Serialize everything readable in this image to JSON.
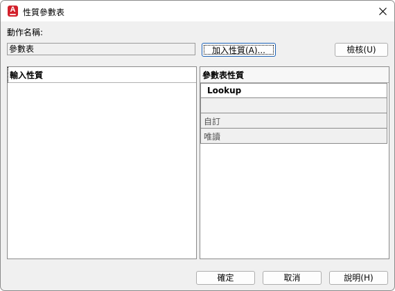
{
  "window": {
    "title": "性質參數表"
  },
  "action": {
    "name_label": "動作名稱:",
    "name_value": "參數表"
  },
  "buttons": {
    "add_property": "加入性質(A)...",
    "audit": "檢核(U)",
    "ok": "確定",
    "cancel": "取消",
    "help": "說明(H)"
  },
  "input_panel": {
    "header": "輸入性質"
  },
  "lookup_panel": {
    "header": "參數表性質",
    "rows": [
      "Lookup",
      "",
      "自訂",
      "唯讀"
    ]
  },
  "colors": {
    "accent": "#1a5fb4",
    "app_icon": "#d3202b"
  },
  "icons": {
    "app": "autocad-a-icon",
    "close": "close-icon"
  }
}
